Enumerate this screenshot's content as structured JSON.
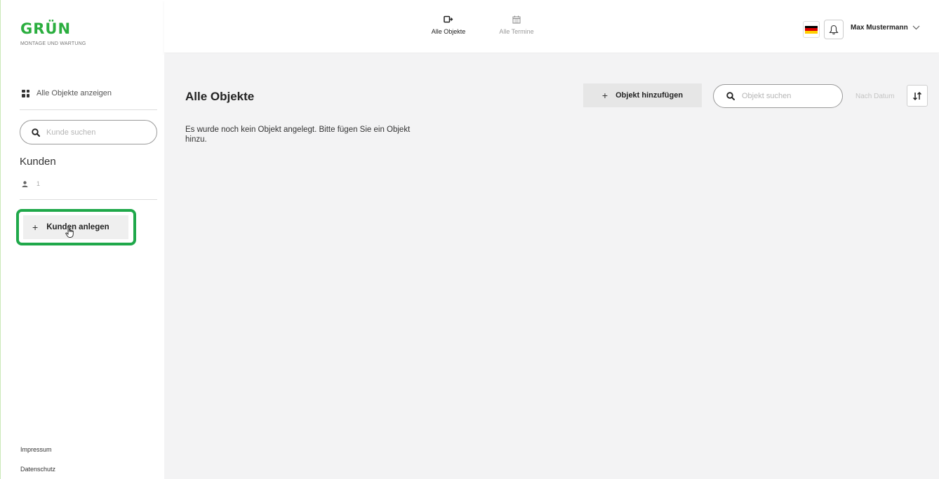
{
  "brand": {
    "name": "GRÜN",
    "tagline": "MONTAGE UND WARTUNG"
  },
  "sidebar": {
    "show_all_label": "Alle Objekte anzeigen",
    "search_placeholder": "Kunde suchen",
    "customers_title": "Kunden",
    "customer_count": "1",
    "add_customer_label": "Kunden anlegen",
    "footer": {
      "imprint": "Impressum",
      "privacy": "Datenschutz"
    }
  },
  "topnav": {
    "tabs": [
      {
        "label": "Alle Objekte",
        "icon": "object-icon",
        "active": true
      },
      {
        "label": "Alle Termine",
        "icon": "calendar-icon",
        "active": false
      }
    ],
    "language_flag": "de-flag-icon",
    "user_name": "Max Mustermann"
  },
  "main": {
    "title": "Alle Objekte",
    "add_object_label": "Objekt hinzufügen",
    "search_placeholder": "Objekt suchen",
    "sort_label": "Nach Datum",
    "empty_message": "Es wurde noch kein Objekt angelegt. Bitte fügen Sie ein Objekt hinzu."
  },
  "colors": {
    "brand_green": "#2bae3f",
    "highlight_green": "#1fa84a",
    "main_bg": "#f3f3f4",
    "button_bg": "#e6e6e6"
  }
}
